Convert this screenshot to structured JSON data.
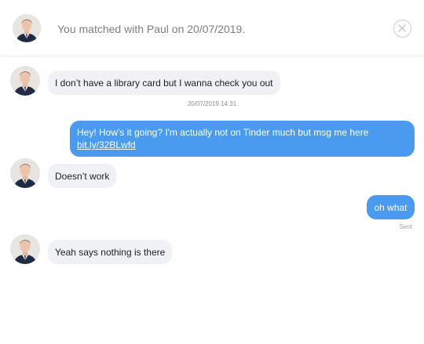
{
  "header": {
    "match_text": "You matched with Paul on 20/07/2019.",
    "avatar_icon": "profile-photo-man-suit",
    "close_icon": "circle-x-icon"
  },
  "messages": [
    {
      "sender": "Paul",
      "direction": "incoming",
      "text": "I don’t have a library card but I wanna check you out"
    },
    {
      "direction": "timestamp",
      "text": "20/07/2019 14:31"
    },
    {
      "sender": "me",
      "direction": "outgoing",
      "text": "Hey! How's it going? I'm actually not on Tinder much but msg me here",
      "link": "bit.ly/32BLwfd"
    },
    {
      "sender": "Paul",
      "direction": "incoming",
      "text": "Doesn’t work"
    },
    {
      "sender": "me",
      "direction": "outgoing",
      "text": "oh what"
    },
    {
      "direction": "status",
      "text": "Sent"
    },
    {
      "sender": "Paul",
      "direction": "incoming",
      "text": "Yeah says nothing is there"
    }
  ],
  "colors": {
    "outgoing_bubble": "#4a9bef",
    "incoming_bubble": "#eff1f4",
    "header_text": "#7a7f87"
  }
}
